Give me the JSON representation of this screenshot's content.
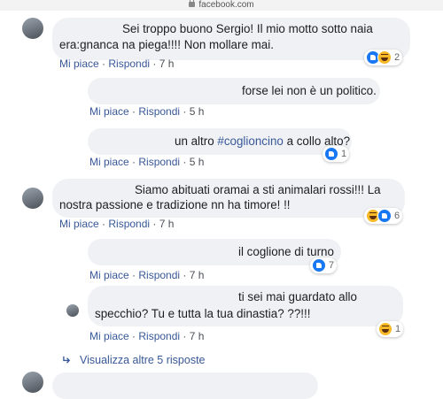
{
  "browser": {
    "url": "facebook.com"
  },
  "comments": [
    {
      "lines": [
        "Sei troppo buono Sergio! Il mio motto sotto naia",
        "era:gnanca na piega!!!! Non mollare mai."
      ],
      "like": "Mi piace",
      "reply": "Rispondi",
      "time": "7 h",
      "reactions": [
        "like",
        "haha"
      ],
      "count": "2"
    },
    {
      "lines": [
        "forse lei non è un politico."
      ],
      "like": "Mi piace",
      "reply": "Rispondi",
      "time": "5 h"
    },
    {
      "pre": "un altro ",
      "hashtag": "#coglioncino",
      "post": " a collo alto?",
      "like": "Mi piace",
      "reply": "Rispondi",
      "time": "5 h",
      "reactions": [
        "like"
      ],
      "count": "1"
    },
    {
      "lines": [
        "Siamo abituati oramai a sti animalari rossi!!! La",
        "nostra passione e tradizione nn ha timore! !!"
      ],
      "like": "Mi piace",
      "reply": "Rispondi",
      "time": "7 h",
      "reactions": [
        "haha",
        "like"
      ],
      "count": "6"
    },
    {
      "lines": [
        "il coglione di turno"
      ],
      "like": "Mi piace",
      "reply": "Rispondi",
      "time": "7 h",
      "reactions": [
        "like"
      ],
      "count": "7"
    },
    {
      "lines": [
        "ti sei mai guardato allo",
        "specchio? Tu e tutta la tua dinastia? ??!!!"
      ],
      "like": "Mi piace",
      "reply": "Rispondi",
      "time": "7 h",
      "reactions": [
        "haha"
      ],
      "count": "1"
    }
  ],
  "more_replies": "Visualizza altre 5 risposte",
  "separator": "·"
}
